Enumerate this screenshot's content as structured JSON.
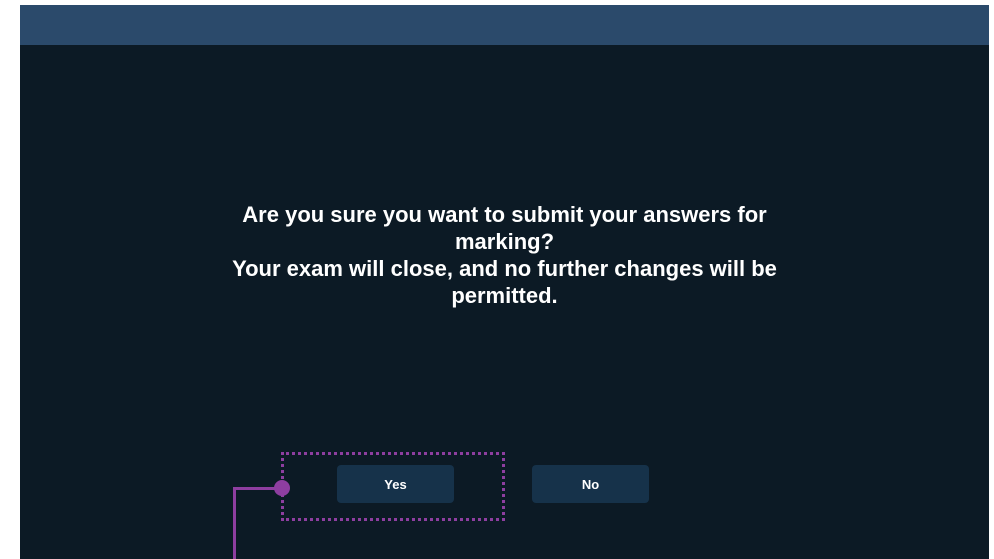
{
  "dialog": {
    "message_lines": [
      "Are you sure you want to submit your answers for",
      "marking?",
      "Your exam will close, and no further changes will be",
      "permitted."
    ],
    "yes_label": "Yes",
    "no_label": "No"
  },
  "colors": {
    "background": "#0c1a25",
    "topbar": "#2b4a6b",
    "button": "#16324a",
    "annotation": "#8e3ea0"
  }
}
